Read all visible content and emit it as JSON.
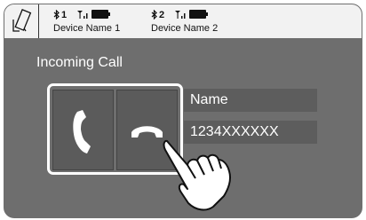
{
  "statusbar": {
    "phone_icon": "phone-pencil-icon",
    "devices": [
      {
        "bt_icon": "bluetooth-icon",
        "index": "1",
        "signal_icon": "signal-icon",
        "battery_icon": "battery-icon",
        "name": "Device Name 1"
      },
      {
        "bt_icon": "bluetooth-icon",
        "index": "2",
        "signal_icon": "signal-icon",
        "battery_icon": "battery-icon",
        "name": "Device Name 2"
      }
    ]
  },
  "main": {
    "title": "Incoming Call",
    "answer_icon": "answer-call-icon",
    "reject_icon": "reject-call-icon",
    "caller_name": "Name",
    "caller_number": "1234XXXXXX",
    "pointer_icon": "hand-pointer-icon"
  },
  "colors": {
    "background": "#6e6e6e",
    "statusbar": "#f2f2f2",
    "button": "#5b5b5b",
    "highlight": "#ffffff"
  }
}
